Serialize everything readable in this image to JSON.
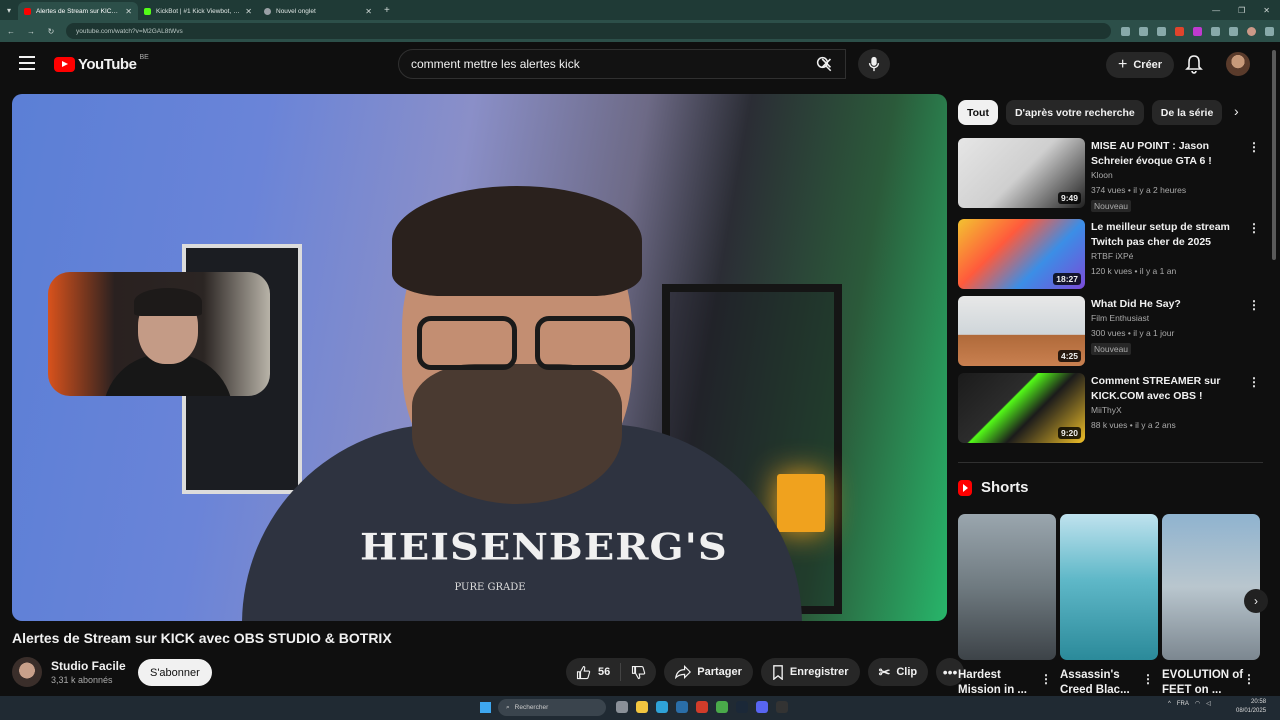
{
  "browser": {
    "tabs": [
      {
        "title": "Alertes de Stream sur KICK avec",
        "active": true,
        "favicon_color": "#ff0000"
      },
      {
        "title": "KickBot | #1 Kick Viewbot, Chat",
        "active": false,
        "favicon_color": "#53fc18"
      },
      {
        "title": "Nouvel onglet",
        "active": false,
        "favicon_color": "#9aa0a6"
      }
    ],
    "url": "youtube.com/watch?v=M2GAL8tWvs"
  },
  "header": {
    "logo_text": "YouTube",
    "country_code": "BE",
    "search_query": "comment mettre les alertes kick",
    "create_label": "Créer"
  },
  "video": {
    "title": "Alertes de Stream sur KICK avec OBS STUDIO & BOTRIX",
    "shirt_text": "HEISENBERG'S",
    "shirt_sub": "PURE GRADE",
    "channel_name": "Studio Facile",
    "subscribers": "3,31 k abonnés",
    "subscribe_label": "S'abonner",
    "likes": "56",
    "share_label": "Partager",
    "save_label": "Enregistrer",
    "clip_label": "Clip"
  },
  "filters": [
    "Tout",
    "D'après votre recherche",
    "De la série"
  ],
  "recommendations": [
    {
      "title": "MISE AU POINT : Jason Schreier évoque GTA 6 !",
      "channel": "Kloon",
      "meta": "374 vues • il y a 2 heures",
      "badge": "Nouveau",
      "duration": "9:49",
      "thumb_bg": "linear-gradient(135deg,#e6e6e6 0%,#cfcfcf 50%,#202020 100%)"
    },
    {
      "title": "Le meilleur setup de stream Twitch pas cher de 2025",
      "channel": "RTBF iXPé",
      "meta": "120 k vues • il y a 1 an",
      "badge": "",
      "duration": "18:27",
      "thumb_bg": "linear-gradient(135deg,#f3c230 0%,#ff5a3c 35%,#3b8ee6 65%,#7a4ad8 100%)"
    },
    {
      "title": "What Did He Say?",
      "channel": "Film Enthusiast",
      "meta": "300 vues • il y a 1 jour",
      "badge": "Nouveau",
      "duration": "4:25",
      "thumb_bg": "linear-gradient(180deg,#e8e8e8 0%,#cfd6da 55%,#b06a3a 56%,#c98050 100%)"
    },
    {
      "title": "Comment  STREAMER sur KICK.COM avec OBS !",
      "channel": "MiiThyX",
      "meta": "88 k vues • il y a 2 ans",
      "badge": "",
      "duration": "9:20",
      "thumb_bg": "linear-gradient(135deg,#1b1b1b 0%,#2c2c2c 40%,#53fc18 41%,#1b1b1b 60%,#f0c028 100%)"
    }
  ],
  "shorts": {
    "heading": "Shorts",
    "items": [
      {
        "title": "Hardest Mission in ...",
        "bg": "linear-gradient(180deg,#9aa6ae 0%,#6f7a80 50%,#3d4348 100%)"
      },
      {
        "title": "Assassin's Creed Blac...",
        "bg": "linear-gradient(180deg,#bfe2ee 0%,#5fb8c8 45%,#2b8a9a 100%)"
      },
      {
        "title": "EVOLUTION of FEET on ...",
        "bg": "linear-gradient(180deg,#8fb3cf 0%,#b9c6ce 50%,#7c8790 100%)"
      }
    ]
  },
  "taskbar": {
    "search_placeholder": "Rechercher",
    "lang": "FRA",
    "time": "20:58",
    "date": "08/01/2025"
  },
  "colors": {
    "youtube_red": "#ff0000",
    "background": "#0f0f0f",
    "chip": "#272727"
  }
}
